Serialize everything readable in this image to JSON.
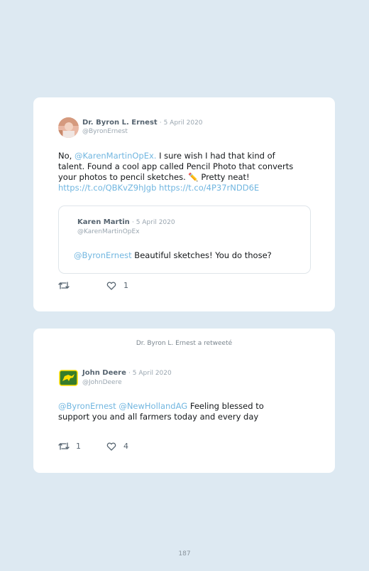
{
  "tweet1": {
    "author": "Dr. Byron L. Ernest",
    "date": "· 5 April 2020",
    "handle": "@ByronErnest",
    "text_prefix": "No, ",
    "mention": "@KarenMartinOpEx.",
    "text_line1_rest": " I sure wish I had that kind of",
    "text_line2": "talent. Found a cool app called Pencil Photo that converts",
    "text_line3": "your photos to pencil sketches. ✏️ Pretty neat!",
    "link1": "https://t.co/QBKvZ9hJgb",
    "link2": "https://t.co/4P37rNDD6E",
    "likes": "1",
    "quoted": {
      "author": "Karen Martin",
      "date": "· 5 April 2020",
      "handle": "@KarenMartinOpEx",
      "mention": "@ByronErnest",
      "text": " Beautiful sketches! You do those?"
    }
  },
  "tweet2": {
    "retweet_banner": "Dr. Byron L. Ernest a retweeté",
    "author": "John Deere",
    "date": "· 5 April 2020",
    "handle": "@JohnDeere",
    "mention1": "@ByronErnest",
    "mention2": "@NewHollandAG",
    "text_line1_rest": " Feeling blessed to",
    "text_line2": "support you and all farmers today and every day",
    "retweets": "1",
    "likes": "4"
  },
  "page_number": "187",
  "icons": [
    "retweet-icon",
    "heart-icon",
    "john-deere-logo",
    "avatar-photo"
  ],
  "colors": {
    "background": "#dde9f2",
    "link": "#71b6e0",
    "card": "#ffffff",
    "deere_green": "#367c2b",
    "deere_yellow": "#ffde00"
  }
}
